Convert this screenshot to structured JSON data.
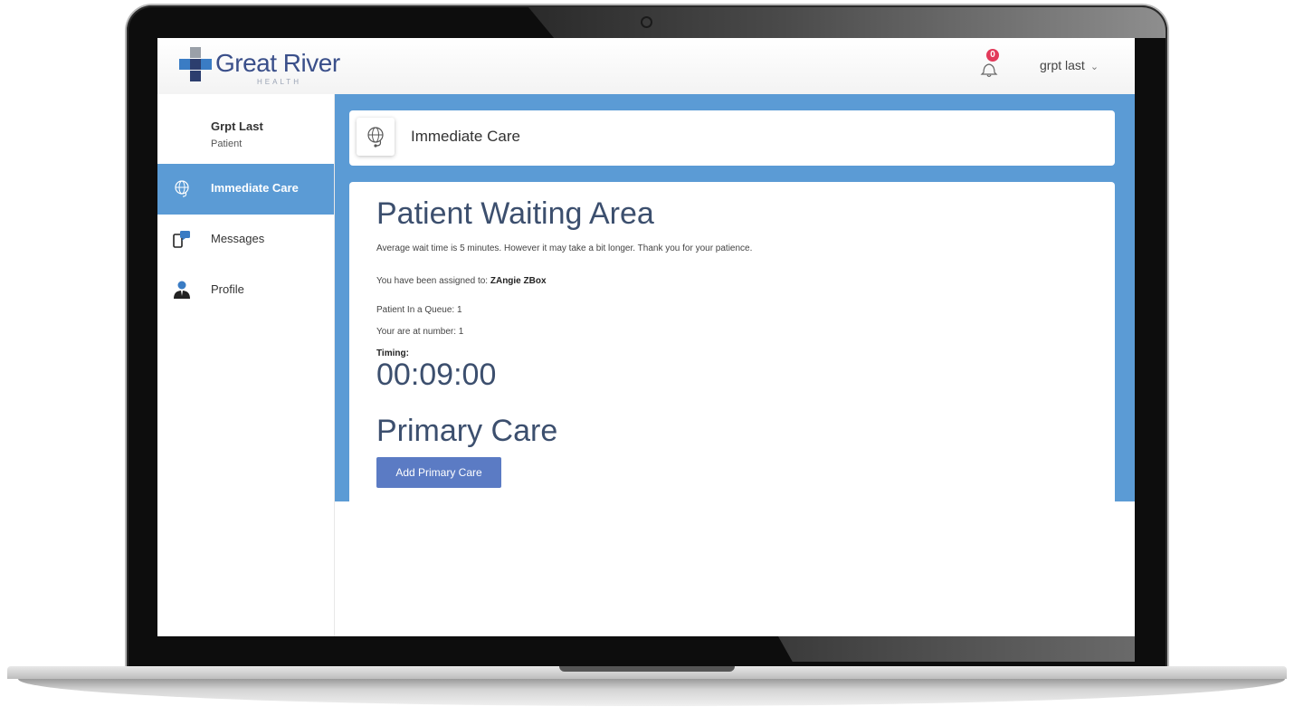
{
  "header": {
    "logo_text": "Great River",
    "logo_sub": "HEALTH",
    "notification_count": "0",
    "user_menu_label": "grpt last",
    "user_menu_chevron": "⌄"
  },
  "sidebar": {
    "user_name": "Grpt Last",
    "user_role": "Patient",
    "items": [
      {
        "label": "Immediate Care",
        "icon": "stethoscope-globe-icon",
        "active": true
      },
      {
        "label": "Messages",
        "icon": "phone-chat-icon",
        "active": false
      },
      {
        "label": "Profile",
        "icon": "person-icon",
        "active": false
      }
    ]
  },
  "main": {
    "header_title": "Immediate Care",
    "waiting_title": "Patient Waiting Area",
    "wait_message": "Average wait time is 5 minutes. However it may take a bit longer. Thank you for your patience.",
    "assigned_prefix": "You have been assigned to: ",
    "assigned_name": "ZAngie ZBox",
    "queue_text": "Patient In a Queue: 1",
    "position_text": "Your are at number: 1",
    "timing_label": "Timing:",
    "timer_value": "00:09:00",
    "primary_care_title": "Primary Care",
    "add_primary_care_label": "Add Primary Care"
  },
  "colors": {
    "accent_blue": "#5b9bd5",
    "button_blue": "#5b7bc4",
    "heading": "#3c4f6e",
    "badge_red": "#e23a5a"
  }
}
